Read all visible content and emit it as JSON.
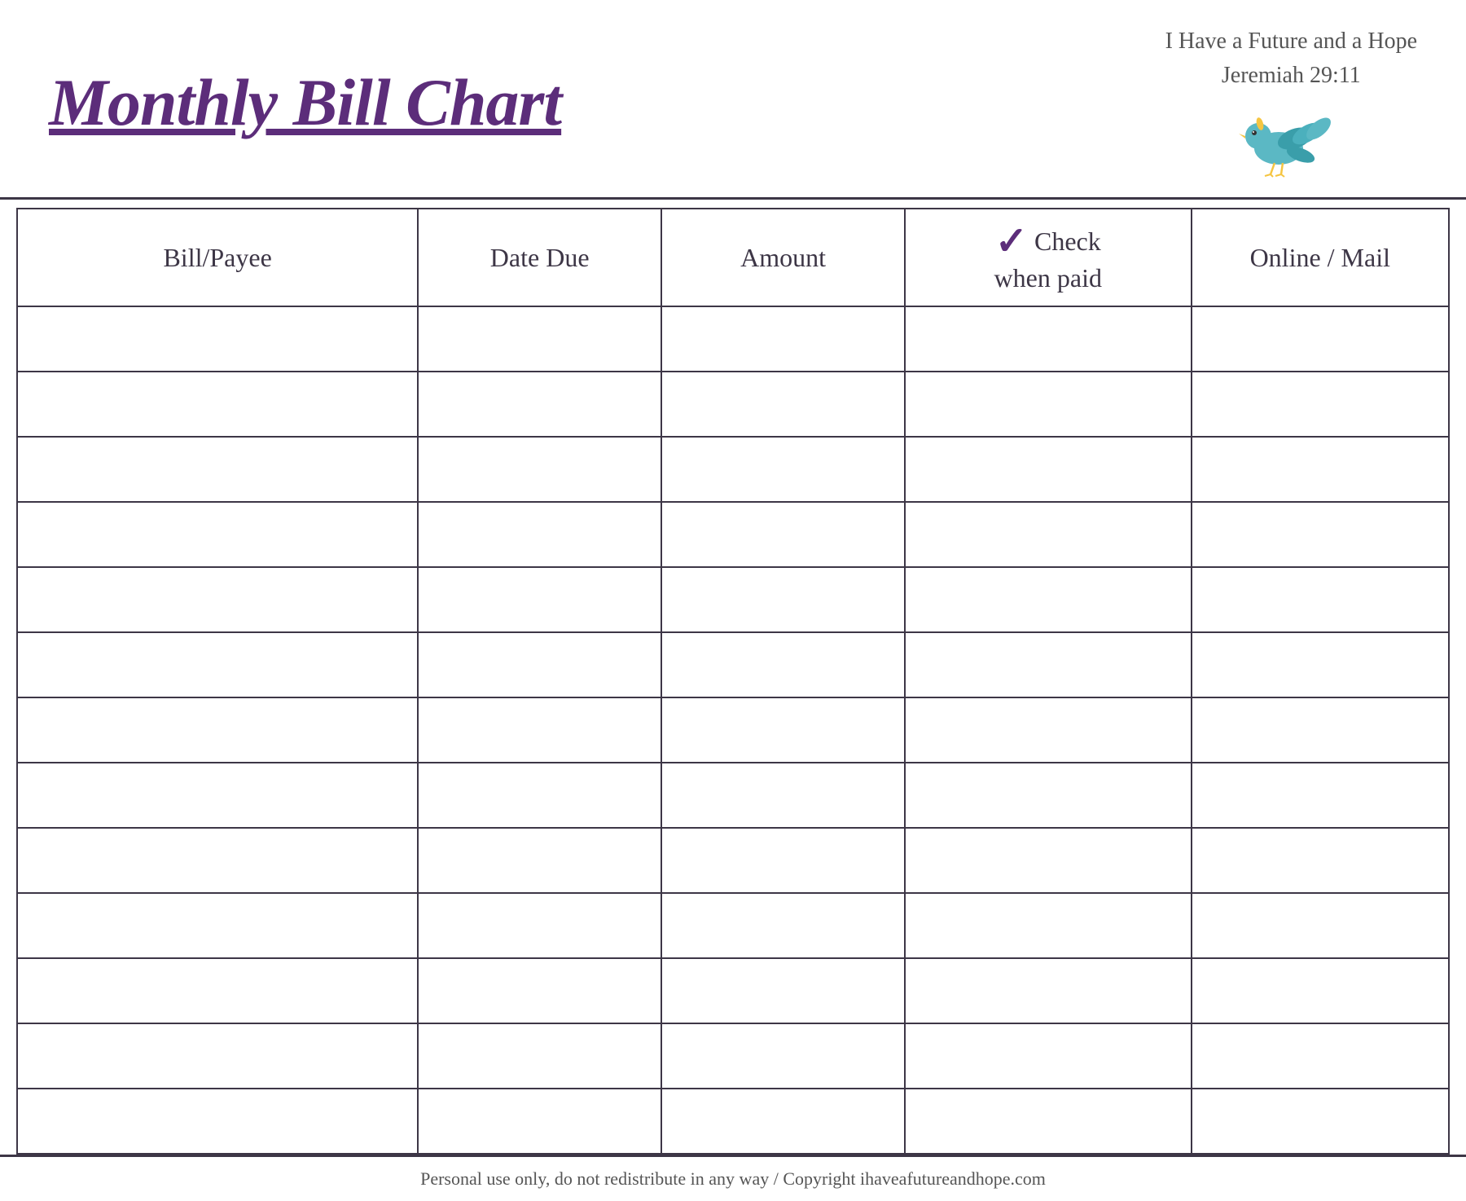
{
  "header": {
    "title": "Monthly Bill Chart",
    "scripture_line1": "I Have a Future and a Hope",
    "scripture_line2": "Jeremiah 29:11"
  },
  "table": {
    "columns": [
      {
        "id": "bill",
        "label": "Bill/Payee"
      },
      {
        "id": "date",
        "label": "Date Due"
      },
      {
        "id": "amount",
        "label": "Amount"
      },
      {
        "id": "check",
        "label_top": "Check",
        "label_bottom": "when paid",
        "has_checkmark": true
      },
      {
        "id": "online",
        "label": "Online / Mail"
      }
    ],
    "row_count": 13
  },
  "footer": {
    "text": "Personal use only, do not redistribute in any way / Copyright ihaveafutureandhope.com"
  },
  "colors": {
    "title": "#5c2d7a",
    "border": "#3d3646",
    "checkmark": "#5c2d7a",
    "text": "#3d3646",
    "secondary_text": "#555555"
  }
}
